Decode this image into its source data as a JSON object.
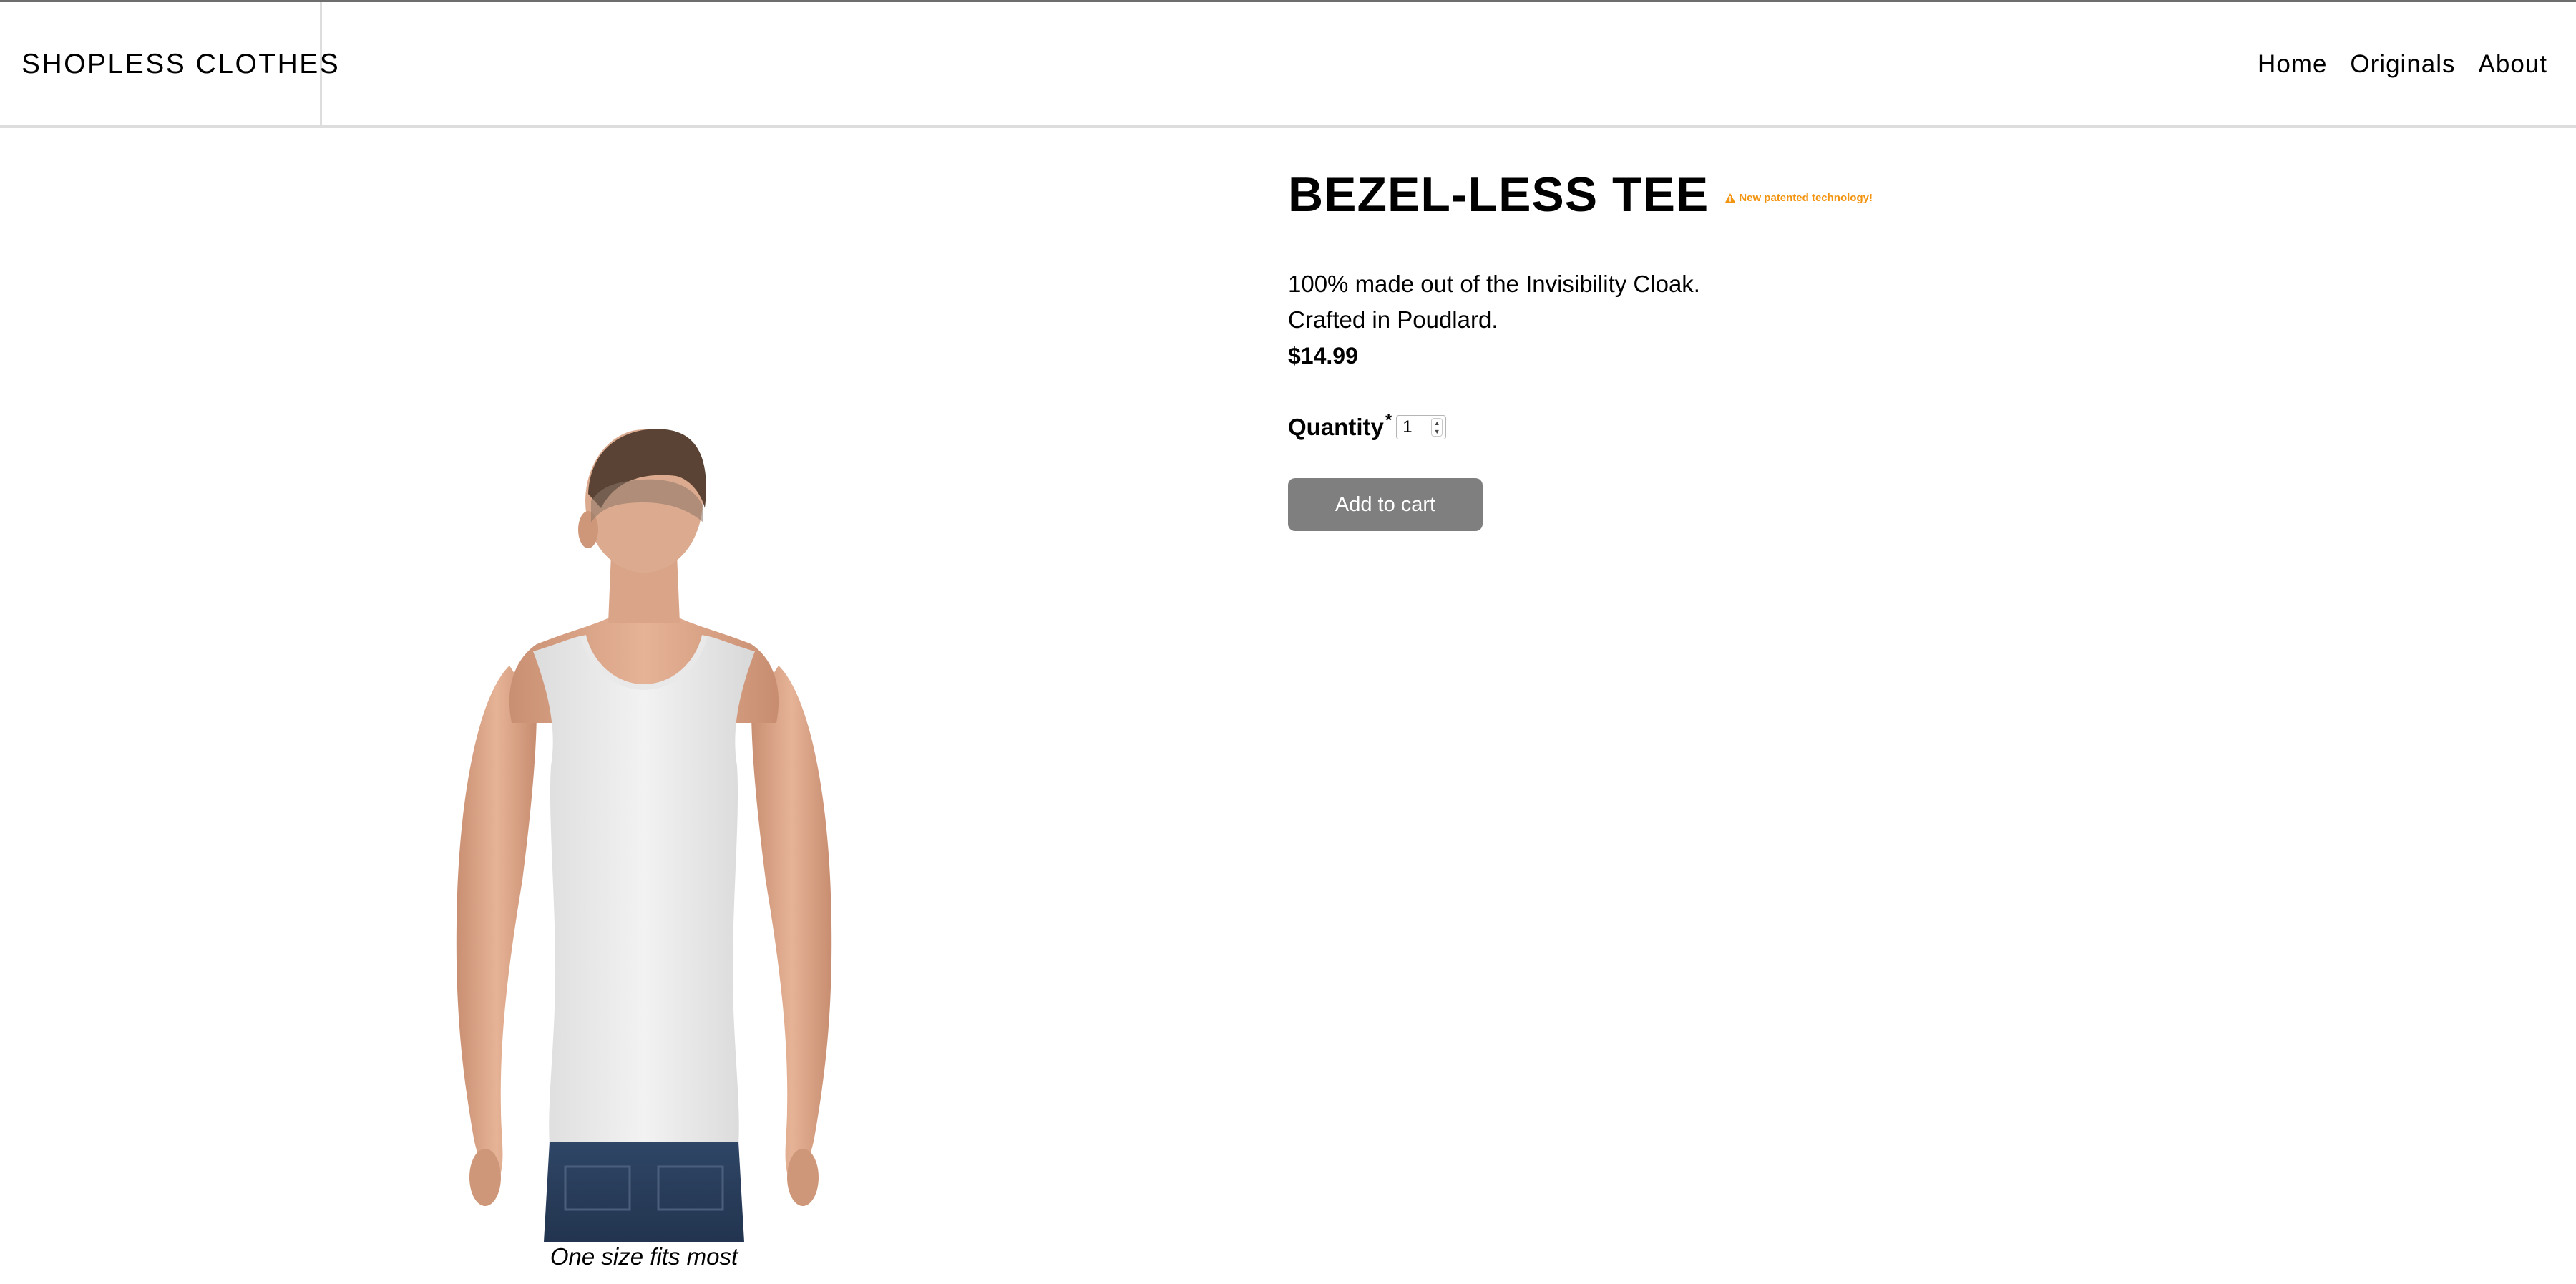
{
  "header": {
    "brand": "SHOPLESS CLOTHES",
    "nav": [
      {
        "label": "Home"
      },
      {
        "label": "Originals"
      },
      {
        "label": "About"
      }
    ]
  },
  "product": {
    "title": "BEZEL-LESS TEE",
    "badge": {
      "icon": "warning-triangle-icon",
      "text": "New patented technology!",
      "color": "#f29410"
    },
    "description_lines": [
      "100% made out of the Invisibility Cloak.",
      "Crafted in Poudlard."
    ],
    "price": "$14.99",
    "quantity": {
      "label": "Quantity",
      "required_marker": "*",
      "value": "1"
    },
    "add_to_cart_label": "Add to cart",
    "image": {
      "caption": "One size fits most"
    }
  },
  "colors": {
    "button_bg": "#7f7f7f",
    "badge": "#f29410",
    "divider": "#dddddd"
  }
}
